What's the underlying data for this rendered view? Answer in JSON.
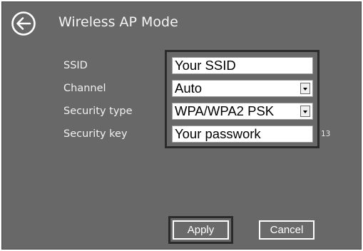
{
  "header": {
    "title": "Wireless AP Mode",
    "back_icon": "back-arrow-circle-icon"
  },
  "form": {
    "ssid": {
      "label": "SSID",
      "value": "Your SSID"
    },
    "channel": {
      "label": "Channel",
      "value": "Auto"
    },
    "security_type": {
      "label": "Security type",
      "value": "WPA/WPA2 PSK"
    },
    "security_key": {
      "label": "Security key",
      "value": "Your passwork",
      "char_count": "13"
    }
  },
  "buttons": {
    "apply": "Apply",
    "cancel": "Cancel"
  },
  "colors": {
    "background": "#686868",
    "text": "#ffffff",
    "field": "#ffffff"
  }
}
